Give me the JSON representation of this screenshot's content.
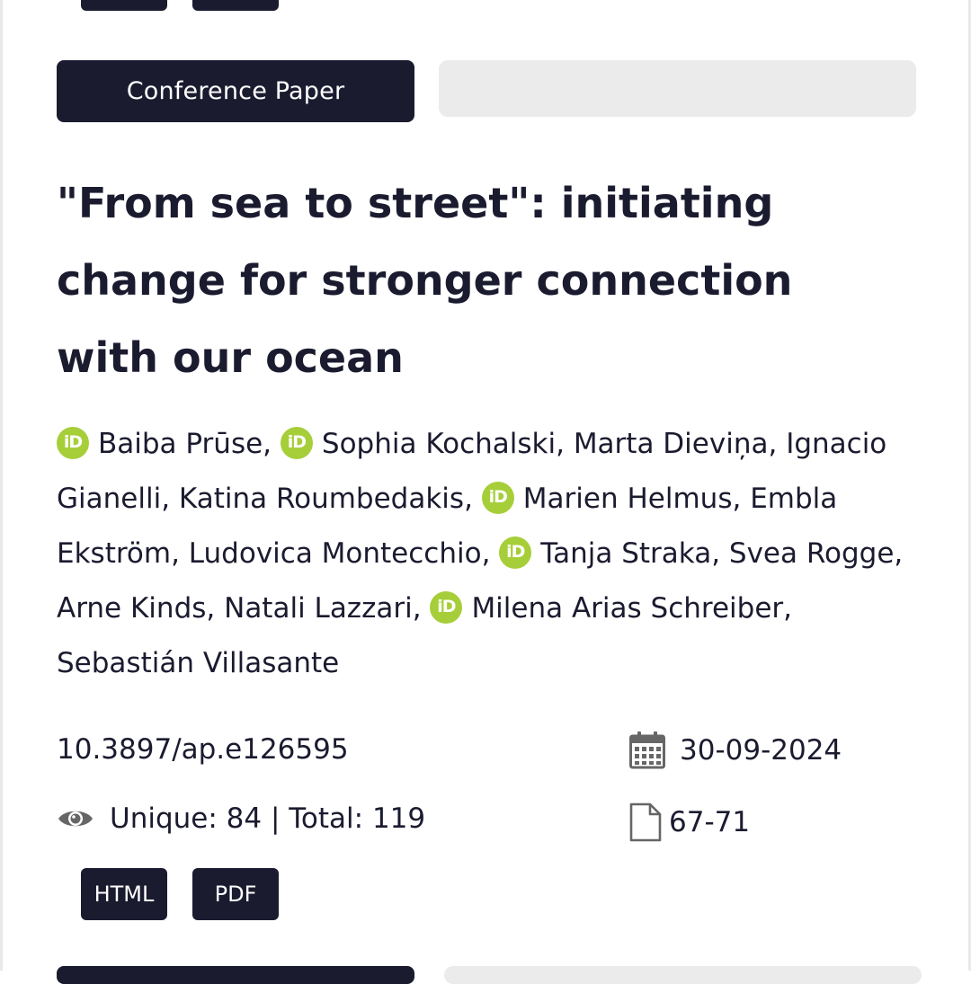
{
  "article": {
    "type_label": "Conference Paper",
    "title": "\"From sea to street\": initiating change for stronger connection with our ocean",
    "authors": [
      {
        "name": "Baiba Prūse",
        "orcid": true
      },
      {
        "name": "Sophia Kochalski",
        "orcid": true
      },
      {
        "name": "Marta Dieviņa",
        "orcid": false
      },
      {
        "name": "Ignacio Gianelli",
        "orcid": false
      },
      {
        "name": "Katina Roumbedakis",
        "orcid": false
      },
      {
        "name": "Marien Helmus",
        "orcid": true
      },
      {
        "name": "Embla Ekström",
        "orcid": false
      },
      {
        "name": "Ludovica Montecchio",
        "orcid": false
      },
      {
        "name": "Tanja Straka",
        "orcid": true
      },
      {
        "name": "Svea Rogge",
        "orcid": false
      },
      {
        "name": "Arne Kinds",
        "orcid": false
      },
      {
        "name": "Natali Lazzari",
        "orcid": false
      },
      {
        "name": "Milena Arias Schreiber",
        "orcid": true
      },
      {
        "name": "Sebastián Villasante",
        "orcid": false
      }
    ],
    "orcid_icon_text": "iD",
    "doi": "10.3897/ap.e126595",
    "date": "30-09-2024",
    "views": "Unique: 84 | Total: 119",
    "pages": "67-71",
    "formats": {
      "html": "HTML",
      "pdf": "PDF"
    }
  },
  "icons": {
    "orcid": "orcid-icon",
    "views": "eye-icon",
    "date": "calendar-icon",
    "pages": "file-icon"
  },
  "colors": {
    "dark": "#1b1b30",
    "orcid_green": "#a6ce39",
    "placeholder_grey": "#ebebeb",
    "icon_grey": "#666666"
  }
}
